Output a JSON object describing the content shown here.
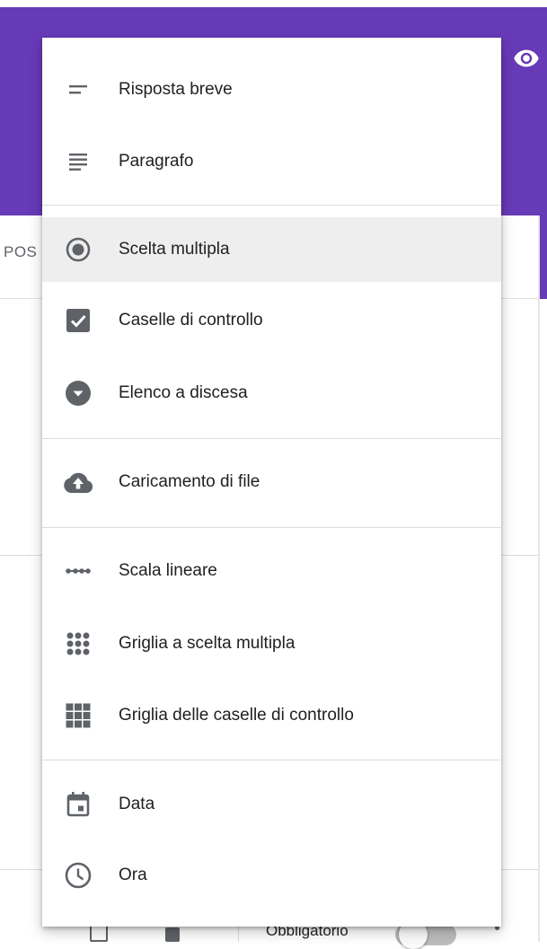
{
  "background": {
    "header_color": "#673ab7",
    "header_icon": "eye-icon",
    "tab_text": "POS",
    "footer": {
      "required_label": "Obbligatorio",
      "icons": [
        "copy-icon",
        "trash-icon",
        "more-icon"
      ]
    }
  },
  "menu": {
    "groups": [
      {
        "items": [
          {
            "label": "Risposta breve",
            "icon": "short-answer-icon",
            "selected": false
          },
          {
            "label": "Paragrafo",
            "icon": "paragraph-icon",
            "selected": false
          }
        ]
      },
      {
        "items": [
          {
            "label": "Scelta multipla",
            "icon": "radio-button-icon",
            "selected": true
          },
          {
            "label": "Caselle di controllo",
            "icon": "checkbox-icon",
            "selected": false
          },
          {
            "label": "Elenco a discesa",
            "icon": "dropdown-icon",
            "selected": false
          }
        ]
      },
      {
        "items": [
          {
            "label": "Caricamento di file",
            "icon": "cloud-upload-icon",
            "selected": false
          }
        ]
      },
      {
        "items": [
          {
            "label": "Scala lineare",
            "icon": "linear-scale-icon",
            "selected": false
          },
          {
            "label": "Griglia a scelta multipla",
            "icon": "radio-grid-icon",
            "selected": false
          },
          {
            "label": "Griglia delle caselle di controllo",
            "icon": "checkbox-grid-icon",
            "selected": false
          }
        ]
      },
      {
        "items": [
          {
            "label": "Data",
            "icon": "calendar-icon",
            "selected": false
          },
          {
            "label": "Ora",
            "icon": "clock-icon",
            "selected": false
          }
        ]
      }
    ],
    "icon_color": "#5f6368",
    "selected_bg": "#eeeeee"
  }
}
